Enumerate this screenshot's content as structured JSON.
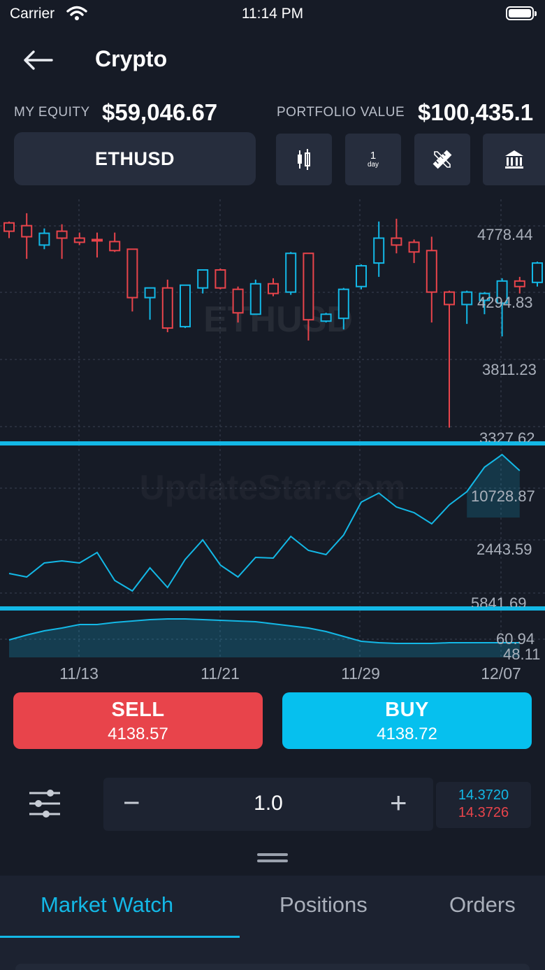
{
  "status_bar": {
    "carrier": "Carrier",
    "time": "11:14 PM"
  },
  "header": {
    "title": "Crypto"
  },
  "equity": {
    "label": "MY EQUITY",
    "value": "$59,046.67"
  },
  "portfolio": {
    "label": "PORTFOLIO VALUE",
    "value": "$100,435.1"
  },
  "symbol": {
    "name": "ETHUSD"
  },
  "toolbar": {
    "candle_icon": "candlestick-icon",
    "period_value": "1",
    "period_unit": "day",
    "draw_icon": "ruler-pencil-icon",
    "indicator_icon": "bank-icon"
  },
  "chart": {
    "watermark": "ETHUSD",
    "watermark2": "UpdateStar.com"
  },
  "chart_data": [
    {
      "type": "candlestick",
      "title": "ETHUSD",
      "y_ticks": [
        "4778.44",
        "4294.83",
        "3811.23",
        "3327.62"
      ],
      "candles": [
        {
          "o": 4740,
          "h": 4810,
          "l": 4690,
          "c": 4800,
          "dir": "down"
        },
        {
          "o": 4700,
          "h": 4870,
          "l": 4540,
          "c": 4780,
          "dir": "down"
        },
        {
          "o": 4640,
          "h": 4760,
          "l": 4610,
          "c": 4725,
          "dir": "up"
        },
        {
          "o": 4690,
          "h": 4790,
          "l": 4540,
          "c": 4740,
          "dir": "down"
        },
        {
          "o": 4660,
          "h": 4730,
          "l": 4640,
          "c": 4690,
          "dir": "down"
        },
        {
          "o": 4670,
          "h": 4730,
          "l": 4550,
          "c": 4680,
          "dir": "down"
        },
        {
          "o": 4600,
          "h": 4730,
          "l": 4590,
          "c": 4665,
          "dir": "down"
        },
        {
          "o": 4260,
          "h": 4610,
          "l": 4160,
          "c": 4610,
          "dir": "down"
        },
        {
          "o": 4260,
          "h": 4330,
          "l": 4100,
          "c": 4330,
          "dir": "up"
        },
        {
          "o": 4040,
          "h": 4390,
          "l": 4010,
          "c": 4330,
          "dir": "down"
        },
        {
          "o": 4050,
          "h": 4350,
          "l": 4040,
          "c": 4350,
          "dir": "up"
        },
        {
          "o": 4330,
          "h": 4440,
          "l": 4290,
          "c": 4460,
          "dir": "up"
        },
        {
          "o": 4330,
          "h": 4470,
          "l": 4320,
          "c": 4460,
          "dir": "down"
        },
        {
          "o": 4150,
          "h": 4340,
          "l": 4080,
          "c": 4320,
          "dir": "down"
        },
        {
          "o": 4140,
          "h": 4390,
          "l": 4140,
          "c": 4360,
          "dir": "up"
        },
        {
          "o": 4290,
          "h": 4400,
          "l": 4270,
          "c": 4360,
          "dir": "down"
        },
        {
          "o": 4300,
          "h": 4590,
          "l": 4280,
          "c": 4580,
          "dir": "up"
        },
        {
          "o": 4100,
          "h": 4580,
          "l": 3950,
          "c": 4580,
          "dir": "down"
        },
        {
          "o": 4090,
          "h": 4150,
          "l": 4080,
          "c": 4140,
          "dir": "up"
        },
        {
          "o": 4110,
          "h": 4330,
          "l": 4030,
          "c": 4320,
          "dir": "up"
        },
        {
          "o": 4340,
          "h": 4500,
          "l": 4320,
          "c": 4490,
          "dir": "up"
        },
        {
          "o": 4510,
          "h": 4810,
          "l": 4410,
          "c": 4690,
          "dir": "up"
        },
        {
          "o": 4640,
          "h": 4830,
          "l": 4580,
          "c": 4690,
          "dir": "down"
        },
        {
          "o": 4590,
          "h": 4680,
          "l": 4510,
          "c": 4660,
          "dir": "down"
        },
        {
          "o": 4300,
          "h": 4700,
          "l": 4080,
          "c": 4600,
          "dir": "down"
        },
        {
          "o": 4210,
          "h": 4310,
          "l": 3320,
          "c": 4300,
          "dir": "down"
        },
        {
          "o": 4210,
          "h": 4310,
          "l": 4070,
          "c": 4300,
          "dir": "up"
        },
        {
          "o": 4240,
          "h": 4300,
          "l": 4140,
          "c": 4290,
          "dir": "up"
        },
        {
          "o": 4220,
          "h": 4400,
          "l": 3980,
          "c": 4380,
          "dir": "up"
        },
        {
          "o": 4340,
          "h": 4410,
          "l": 4290,
          "c": 4380,
          "dir": "down"
        },
        {
          "o": 4370,
          "h": 4520,
          "l": 4340,
          "c": 4510,
          "dir": "up"
        },
        {
          "o": 4180,
          "h": 4550,
          "l": 4180,
          "c": 4500,
          "dir": "down"
        }
      ]
    },
    {
      "type": "line",
      "y_ticks": [
        "10728.87",
        "2443.59",
        "5841.69"
      ],
      "values": [
        820,
        825,
        805,
        802,
        805,
        790,
        830,
        845,
        812,
        840,
        800,
        772,
        808,
        825,
        797,
        798,
        767,
        787,
        793,
        765,
        718,
        705,
        725,
        733,
        749,
        722,
        703,
        668,
        650,
        673
      ]
    },
    {
      "type": "area",
      "y_ticks": [
        "60.94",
        "48.11"
      ],
      "x_labels": [
        "11/13",
        "11/21",
        "11/29",
        "12/07"
      ],
      "values": [
        915,
        908,
        902,
        898,
        893,
        893,
        890,
        888,
        886,
        885,
        885,
        886,
        887,
        888,
        889,
        892,
        895,
        898,
        903,
        910,
        917,
        919,
        920,
        920,
        920,
        919,
        919,
        919,
        919,
        919
      ]
    }
  ],
  "trade": {
    "sell_label": "SELL",
    "sell_price": "4138.57",
    "buy_label": "BUY",
    "buy_price": "4138.72",
    "sell_color": "#e8444b",
    "buy_color": "#06c0ee"
  },
  "quantity": {
    "minus": "−",
    "value": "1.0",
    "plus": "+"
  },
  "prices": {
    "bid": "14.3720",
    "ask": "14.3726"
  },
  "tabs": {
    "items": [
      "Market Watch",
      "Positions",
      "Orders"
    ],
    "active": 0
  },
  "colors": {
    "accent": "#13b8e6",
    "red": "#e8444b",
    "bg": "#161b26"
  }
}
